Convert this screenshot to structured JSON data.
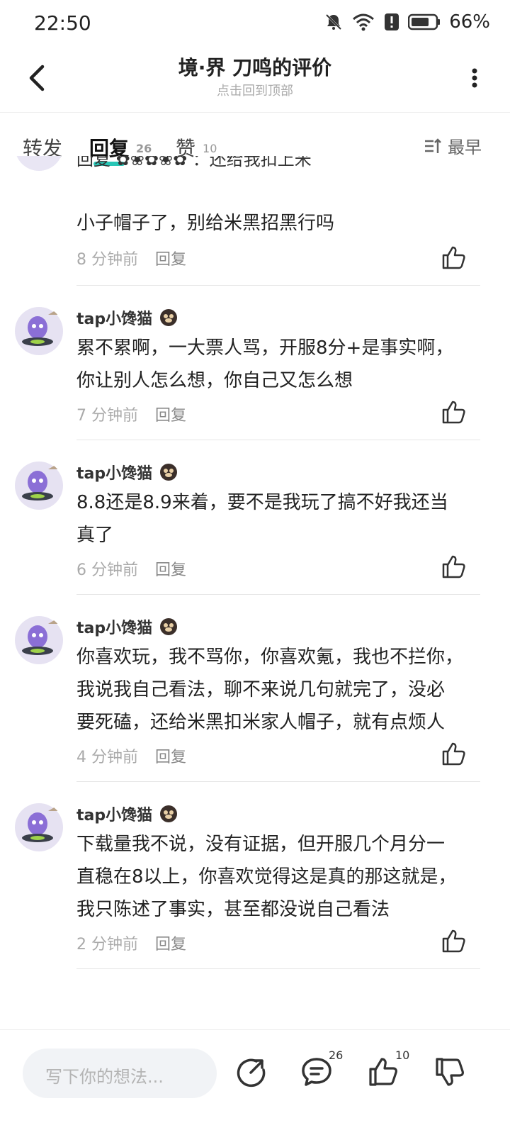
{
  "status_bar": {
    "time": "22:50",
    "battery": "66%"
  },
  "header": {
    "title": "境·界 刀鸣的评价",
    "subtitle": "点击回到顶部"
  },
  "tabs": [
    {
      "label": "转发",
      "count": ""
    },
    {
      "label": "回复",
      "count": "26"
    },
    {
      "label": "赞",
      "count": "10"
    }
  ],
  "sort_label": "最早",
  "cut_comment": {
    "line1": "回复 ✿❀✿❀✿ ：还给我扣上米",
    "line2": "小子帽子了，别给米黑招黑行吗",
    "time": "8 分钟前",
    "reply_label": "回复"
  },
  "comments": [
    {
      "user": "tap小馋猫",
      "lines": [
        "累不累啊，一大票人骂，开服8分+是事实啊，",
        "你让别人怎么想，你自己又怎么想"
      ],
      "time": "7 分钟前",
      "reply_label": "回复"
    },
    {
      "user": "tap小馋猫",
      "lines": [
        "8.8还是8.9来着，要不是我玩了搞不好我还当",
        "真了"
      ],
      "time": "6 分钟前",
      "reply_label": "回复"
    },
    {
      "user": "tap小馋猫",
      "lines": [
        "你喜欢玩，我不骂你，你喜欢氪，我也不拦你，",
        "我说我自己看法，聊不来说几句就完了，没必",
        "要死磕，还给米黑扣米家人帽子，就有点烦人"
      ],
      "time": "4 分钟前",
      "reply_label": "回复"
    },
    {
      "user": "tap小馋猫",
      "lines": [
        "下载量我不说，没有证据，但开服几个月分一",
        "直稳在8以上，你喜欢觉得这是真的那这就是，",
        "我只陈述了事实，甚至都没说自己看法"
      ],
      "time": "2 分钟前",
      "reply_label": "回复"
    }
  ],
  "bottom_bar": {
    "input_placeholder": "写下你的想法...",
    "comment_count": "26",
    "like_count": "10"
  },
  "colors": {
    "accent": "#28c6b6",
    "text": "#222222",
    "muted": "#aaaaaa"
  }
}
